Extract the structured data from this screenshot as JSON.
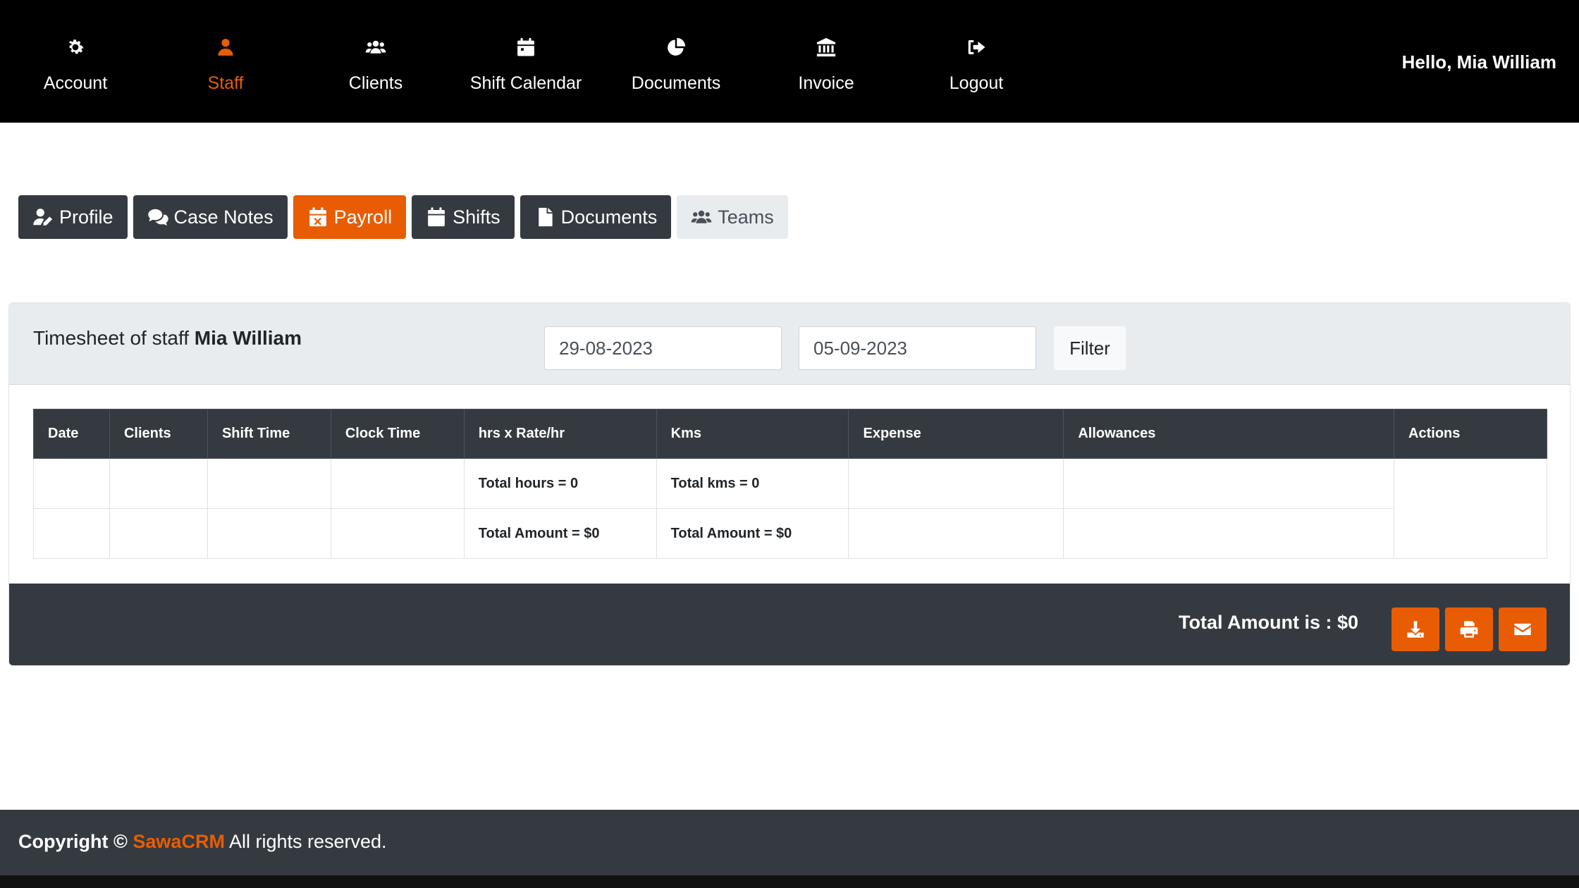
{
  "nav": {
    "items": [
      {
        "label": "Account",
        "icon": "gear-icon"
      },
      {
        "label": "Staff",
        "icon": "user-icon"
      },
      {
        "label": "Clients",
        "icon": "users-icon"
      },
      {
        "label": "Shift Calendar",
        "icon": "calendar-icon"
      },
      {
        "label": "Documents",
        "icon": "pie-chart-icon"
      },
      {
        "label": "Invoice",
        "icon": "bank-icon"
      },
      {
        "label": "Logout",
        "icon": "sign-out-icon"
      }
    ],
    "active": "Staff",
    "greeting": "Hello, Mia William"
  },
  "tabs": [
    {
      "label": "Profile",
      "icon": "user-edit-icon"
    },
    {
      "label": "Case Notes",
      "icon": "comments-icon"
    },
    {
      "label": "Payroll",
      "icon": "calendar-x-icon"
    },
    {
      "label": "Shifts",
      "icon": "calendar-icon"
    },
    {
      "label": "Documents",
      "icon": "file-icon"
    },
    {
      "label": "Teams",
      "icon": "users-icon"
    }
  ],
  "timesheet": {
    "title_prefix": "Timesheet of staff",
    "staff_name": "Mia William",
    "date_from": "29-08-2023",
    "date_to": "05-09-2023",
    "filter_label": "Filter"
  },
  "table": {
    "columns": [
      "Date",
      "Clients",
      "Shift Time",
      "Clock Time",
      "hrs x Rate/hr",
      "Kms",
      "Expense",
      "Allowances",
      "Actions"
    ],
    "total_hours": "Total hours = 0",
    "total_kms": "Total kms = 0",
    "total_amount_hours": "Total Amount = $0",
    "total_amount_kms": "Total Amount = $0"
  },
  "summary": {
    "total_text": "Total Amount is : $0",
    "actions": [
      "download-icon",
      "print-icon",
      "envelope-icon"
    ]
  },
  "footer": {
    "copyright": "Copyright ©",
    "brand": "SawaCRM",
    "rights": "All rights reserved."
  },
  "colors": {
    "accent": "#e85d04",
    "dark": "#343a40",
    "nav_bg": "#000000"
  }
}
